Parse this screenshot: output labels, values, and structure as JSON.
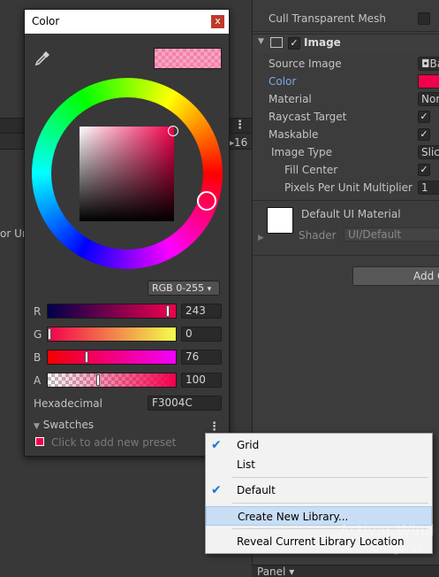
{
  "background_left": {
    "cut_label": "or Uni",
    "num_label": "16"
  },
  "inspector": {
    "cull_label": "Cull Transparent Mesh",
    "component_title": "Image",
    "rows": [
      {
        "label": "Source Image",
        "value": "Ba"
      },
      {
        "label": "Color",
        "value": ""
      },
      {
        "label": "Material",
        "value": "Non"
      },
      {
        "label": "Raycast Target",
        "value": "✓"
      },
      {
        "label": "Maskable",
        "value": "✓"
      },
      {
        "label": "Image Type",
        "value": "Slic"
      },
      {
        "label": "Fill Center",
        "value": "✓"
      },
      {
        "label": "Pixels Per Unit Multiplier",
        "value": "1"
      }
    ],
    "material_name": "Default UI Material",
    "shader_label": "Shader",
    "shader_value": "UI/Default",
    "add_button": "Add C",
    "panel_tab": "Panel"
  },
  "color_window": {
    "title": "Color",
    "close": "x",
    "mode": "RGB 0-255",
    "channels": [
      {
        "label": "R",
        "value": "243",
        "fraction": 0.953
      },
      {
        "label": "G",
        "value": "0",
        "fraction": 0.0
      },
      {
        "label": "B",
        "value": "76",
        "fraction": 0.298
      },
      {
        "label": "A",
        "value": "100",
        "fraction": 0.392
      }
    ],
    "hex_label": "Hexadecimal",
    "hex_value": "F3004C",
    "swatches_label": "Swatches",
    "swatches_hint": "Click to add new preset",
    "current_color": "#f3004c"
  },
  "context_menu": {
    "items": [
      {
        "label": "Grid",
        "checked": true
      },
      {
        "label": "List",
        "checked": false
      },
      {
        "label": "Default",
        "checked": true
      },
      {
        "label": "Create New Library...",
        "checked": false
      },
      {
        "label": "Reveal Current Library Location",
        "checked": false
      }
    ]
  },
  "watermark": {
    "line1": "Activar Wind",
    "line2": "Ve a Configurac"
  }
}
